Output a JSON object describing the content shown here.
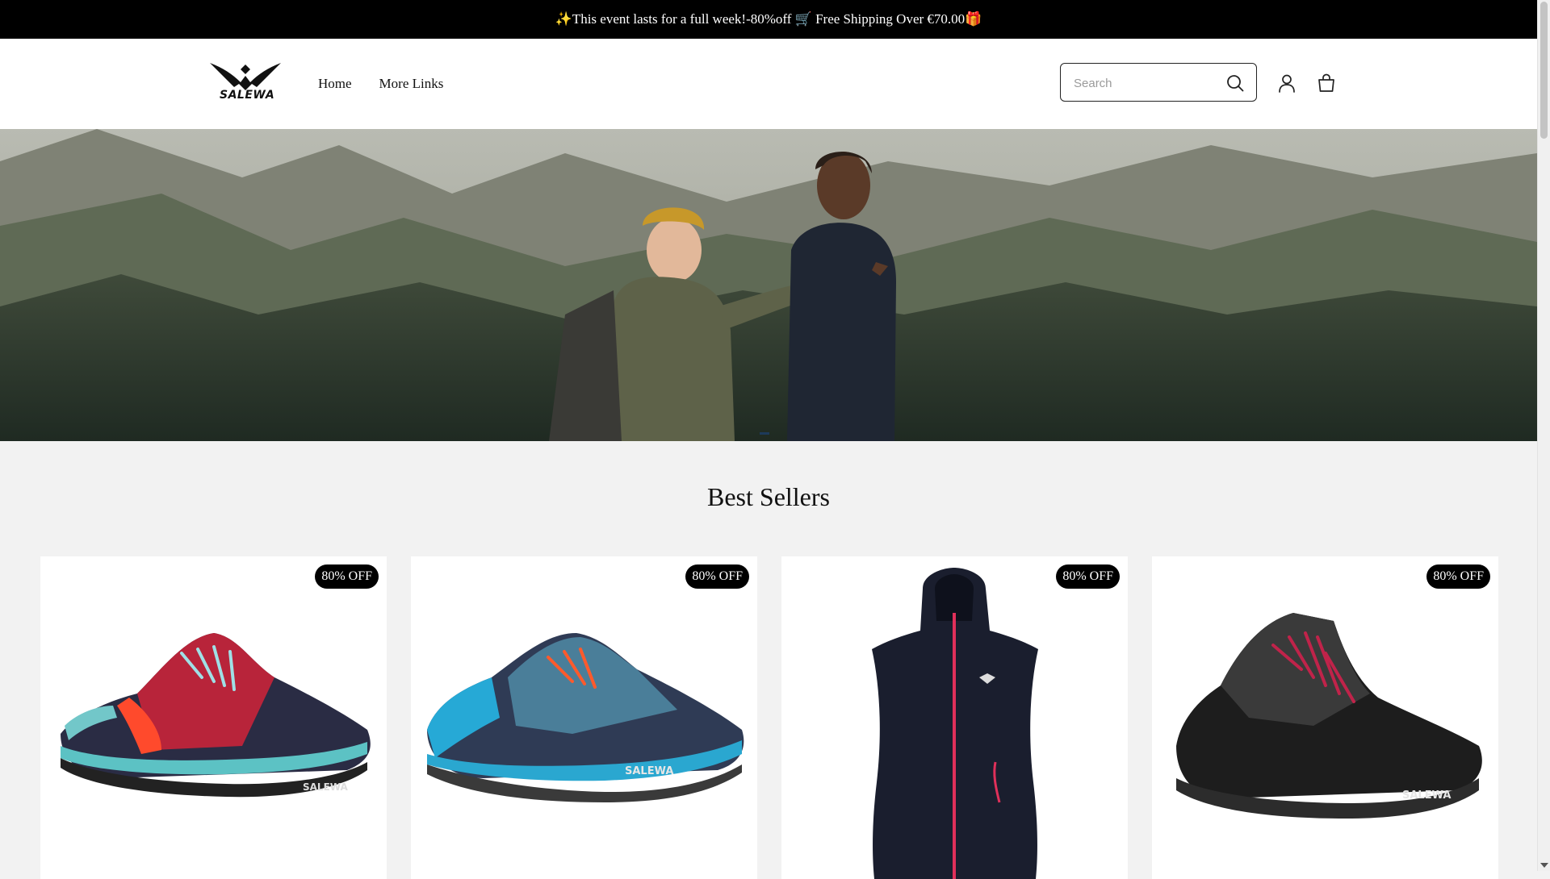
{
  "announcement": {
    "text": "✨This event lasts for a full week!-80%off 🛒 Free Shipping Over €70.00🎁"
  },
  "header": {
    "logo_text": "SALEWA",
    "nav": [
      {
        "label": "Home"
      },
      {
        "label": "More Links"
      }
    ],
    "search": {
      "placeholder": "Search",
      "value": ""
    },
    "icons": {
      "search": "search-icon",
      "account": "user-icon",
      "cart": "shopping-bag-icon"
    }
  },
  "hero": {
    "image": "two hikers on a forested mountain ridge, one pointing",
    "slide_count": 1,
    "active_slide": 1
  },
  "best_sellers": {
    "title": "Best Sellers",
    "products": [
      {
        "badge": "80% OFF",
        "image": "navy trail running shoe with coral and aqua accents"
      },
      {
        "badge": "80% OFF",
        "image": "blue and navy trail shoe with orange laces"
      },
      {
        "badge": "80% OFF",
        "image": "navy softshell vest with pink zipper"
      },
      {
        "badge": "80% OFF",
        "image": "black mid-cut hiking boot with red laces"
      }
    ]
  },
  "colors": {
    "announcement_bg": "#000000",
    "header_bg": "#ffffff",
    "page_bg": "#f2f2f2",
    "badge_bg": "#000000"
  }
}
